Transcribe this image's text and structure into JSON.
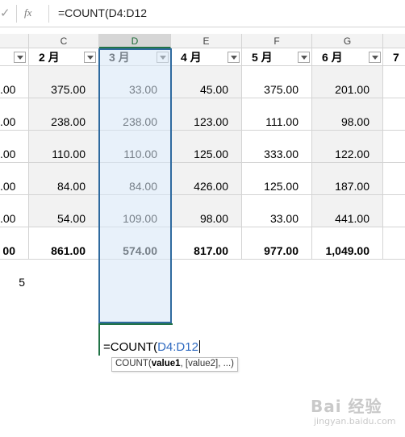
{
  "formula_bar": {
    "check_symbol": "✓",
    "fx_label": "fx",
    "formula": "=COUNT(D4:D12"
  },
  "columns": [
    {
      "letter": "C"
    },
    {
      "letter": "D",
      "selected": true
    },
    {
      "letter": "E"
    },
    {
      "letter": "F"
    },
    {
      "letter": "G"
    }
  ],
  "header_row": {
    "b_partial": "",
    "c": "2 月",
    "d": "3 月",
    "e": "4 月",
    "f": "5 月",
    "g": "6 月",
    "h_partial": "7"
  },
  "rows": [
    {
      "b": ".00",
      "c": "375.00",
      "d": "33.00",
      "e": "45.00",
      "f": "375.00",
      "g": "201.00"
    },
    {
      "b": ".00",
      "c": "238.00",
      "d": "238.00",
      "e": "123.00",
      "f": "111.00",
      "g": "98.00"
    },
    {
      "b": ".00",
      "c": "110.00",
      "d": "110.00",
      "e": "125.00",
      "f": "333.00",
      "g": "122.00"
    },
    {
      "b": ".00",
      "c": "84.00",
      "d": "84.00",
      "e": "426.00",
      "f": "125.00",
      "g": "187.00"
    },
    {
      "b": ".00",
      "c": "54.00",
      "d": "109.00",
      "e": "98.00",
      "f": "33.00",
      "g": "441.00"
    }
  ],
  "total_row": {
    "b": "00",
    "c": "861.00",
    "d": "574.00",
    "e": "817.00",
    "f": "977.00",
    "g": "1,049.00"
  },
  "count_value": "5",
  "editing_cell": {
    "prefix": "=COUNT(",
    "ref": "D4:D12"
  },
  "tooltip": {
    "fn": "COUNT(",
    "arg1": "value1",
    "rest": ", [value2], ...)"
  },
  "watermark": {
    "line1": "Bai 经验",
    "line2": "jingyan.baidu.com"
  }
}
